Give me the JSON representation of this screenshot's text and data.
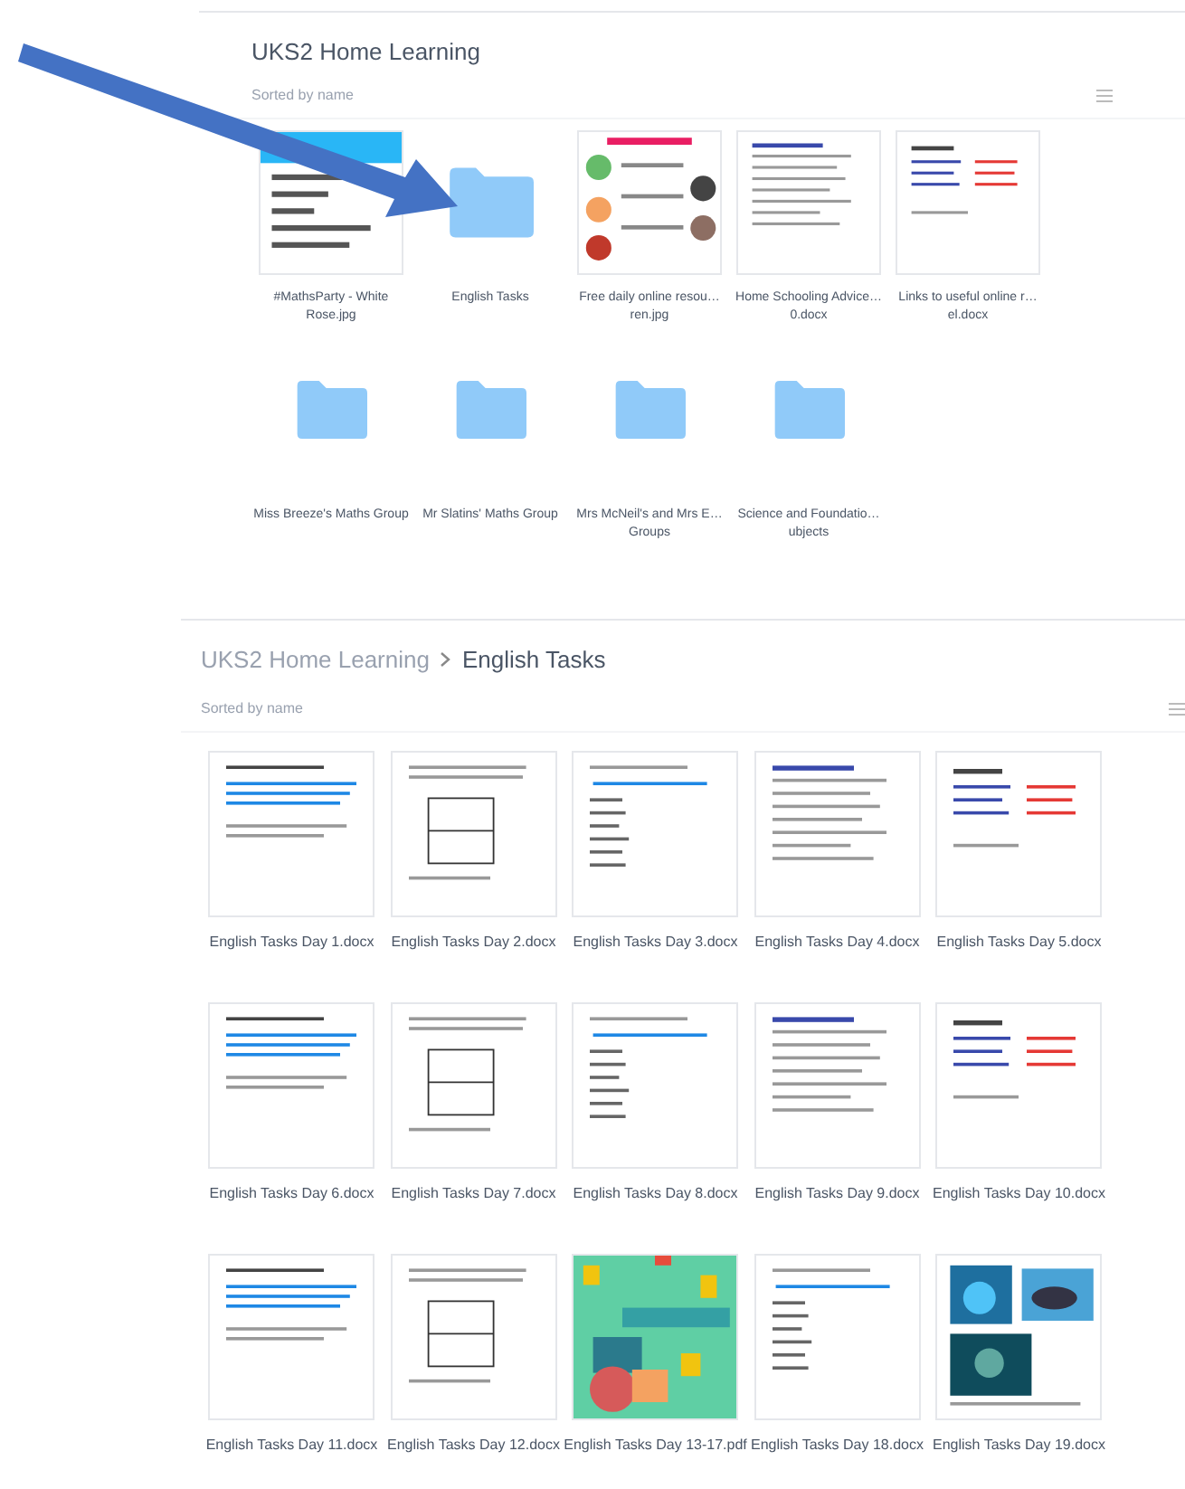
{
  "sections": [
    {
      "breadcrumb": [
        "UKS2 Home Learning"
      ],
      "sort_label": "Sorted by name",
      "items": [
        {
          "kind": "picture",
          "lines": [
            "#MathsParty - White",
            "Rose.jpg"
          ]
        },
        {
          "kind": "folder",
          "lines": [
            "English Tasks"
          ]
        },
        {
          "kind": "picture",
          "lines": [
            "Free daily online resou…",
            "ren.jpg"
          ]
        },
        {
          "kind": "document",
          "lines": [
            "Home Schooling Advice…",
            "0.docx"
          ]
        },
        {
          "kind": "document",
          "lines": [
            "Links to useful online r…",
            "el.docx"
          ]
        },
        {
          "kind": "folder",
          "lines": [
            "Miss Breeze's Maths Group"
          ]
        },
        {
          "kind": "folder",
          "lines": [
            "Mr Slatins' Maths Group"
          ]
        },
        {
          "kind": "folder",
          "lines": [
            "Mrs McNeil's and Mrs E…",
            "Groups"
          ]
        },
        {
          "kind": "folder",
          "lines": [
            "Science and Foundatio…",
            "ubjects"
          ]
        }
      ]
    },
    {
      "breadcrumb": [
        "UKS2 Home Learning",
        "English Tasks"
      ],
      "sort_label": "Sorted by name",
      "items": [
        {
          "kind": "document",
          "lines": [
            "English Tasks Day 1.docx"
          ]
        },
        {
          "kind": "document",
          "lines": [
            "English Tasks Day 2.docx"
          ]
        },
        {
          "kind": "document",
          "lines": [
            "English Tasks Day 3.docx"
          ]
        },
        {
          "kind": "document",
          "lines": [
            "English Tasks Day 4.docx"
          ]
        },
        {
          "kind": "document",
          "lines": [
            "English Tasks Day 5.docx"
          ]
        },
        {
          "kind": "document",
          "lines": [
            "English Tasks Day 6.docx"
          ]
        },
        {
          "kind": "document",
          "lines": [
            "English Tasks Day 7.docx"
          ]
        },
        {
          "kind": "document",
          "lines": [
            "English Tasks Day 8.docx"
          ]
        },
        {
          "kind": "document",
          "lines": [
            "English Tasks Day 9.docx"
          ]
        },
        {
          "kind": "document",
          "lines": [
            "English Tasks Day 10.docx"
          ]
        },
        {
          "kind": "document",
          "lines": [
            "English Tasks Day 11.docx"
          ]
        },
        {
          "kind": "document",
          "lines": [
            "English Tasks Day 12.docx"
          ]
        },
        {
          "kind": "picture",
          "lines": [
            "English Tasks Day 13-17.pdf"
          ]
        },
        {
          "kind": "document",
          "lines": [
            "English Tasks Day 18.docx"
          ]
        },
        {
          "kind": "picture",
          "lines": [
            "English Tasks Day 19.docx"
          ]
        }
      ]
    }
  ]
}
